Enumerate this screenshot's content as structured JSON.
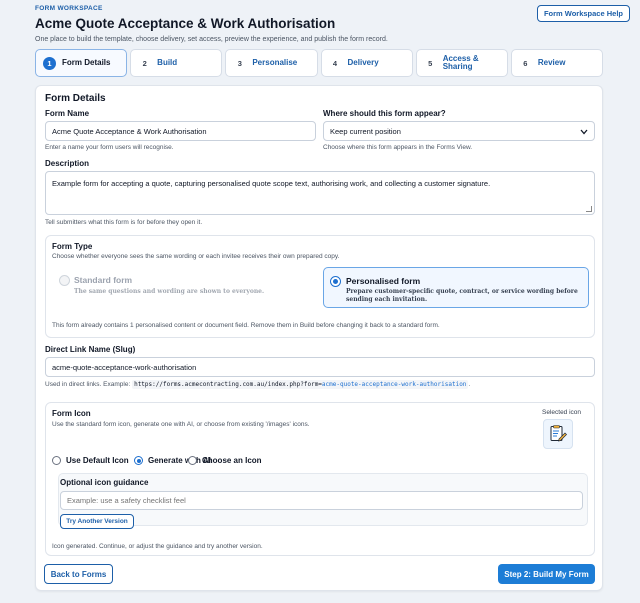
{
  "header": {
    "eyebrow": "FORM WORKSPACE",
    "title": "Acme Quote Acceptance & Work Authorisation",
    "subtitle": "One place to build the template, choose delivery, set access, preview the experience, and publish the form record.",
    "help_label": "Form Workspace Help"
  },
  "steps": [
    {
      "num": "1",
      "label": "Form Details"
    },
    {
      "num": "2",
      "label": "Build"
    },
    {
      "num": "3",
      "label": "Personalise"
    },
    {
      "num": "4",
      "label": "Delivery"
    },
    {
      "num": "5",
      "label": "Access & Sharing"
    },
    {
      "num": "6",
      "label": "Review"
    }
  ],
  "active_step": 1,
  "details": {
    "section_title": "Form Details",
    "form_name": {
      "label": "Form Name",
      "value": "Acme Quote Acceptance & Work Authorisation",
      "hint": "Enter a name your form users will recognise."
    },
    "appear": {
      "label": "Where should this form appear?",
      "value": "Keep current position",
      "hint": "Choose where this form appears in the Forms View."
    },
    "description": {
      "label": "Description",
      "value": "Example form for accepting a quote, capturing personalised quote scope text, authorising work, and collecting a customer signature.",
      "hint": "Tell submitters what this form is for before they open it."
    }
  },
  "form_type": {
    "title": "Form Type",
    "subtitle": "Choose whether everyone sees the same wording or each invitee receives their own prepared copy.",
    "options": [
      {
        "title": "Standard form",
        "desc": "The same questions and wording are shown to everyone."
      },
      {
        "title": "Personalised form",
        "desc": "Prepare customer-specific quote, contract, or service wording before sending each invitation."
      }
    ],
    "selected": "Personalised form",
    "note": "This form already contains 1 personalised content or document field. Remove them in Build before changing it back to a standard form."
  },
  "slug": {
    "label": "Direct Link Name (Slug)",
    "value": "acme-quote-acceptance-work-authorisation",
    "hint_prefix": "Used in direct links. Example:",
    "example_base": "https://forms.acmecontracting.com.au/index.php?form=",
    "example_slug": "acme-quote-acceptance-work-authorisation",
    "hint_suffix": "."
  },
  "form_icon": {
    "title": "Form Icon",
    "subtitle": "Use the standard form icon, generate one with AI, or choose from existing '/images' icons.",
    "selected_label": "Selected icon",
    "selected_icon": "edit-document-icon",
    "choices": [
      "Use Default Icon",
      "Generate with AI",
      "Choose an Icon"
    ],
    "selected_choice": "Generate with AI",
    "guidance_label": "Optional icon guidance",
    "guidance_placeholder": "Example: use a safety checklist feel",
    "retry_label": "Try Another Version",
    "status": "Icon generated. Continue, or adjust the guidance and try another version."
  },
  "footer": {
    "back_label": "Back to Forms",
    "next_label": "Step 2: Build My Form"
  },
  "colors": {
    "accent": "#1d6fcf",
    "primary_button": "#1d7dd6",
    "page_bg": "#eef2f7"
  }
}
